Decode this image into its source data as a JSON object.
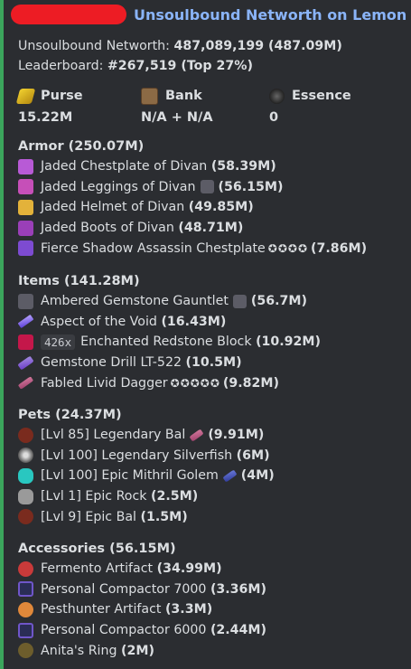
{
  "header": {
    "title": "Unsoulbound Networth on Lemon"
  },
  "summary": {
    "networth_label": "Unsoulbound Networth:",
    "networth_value": "487,089,199 (487.09M)",
    "leaderboard_label": "Leaderboard:",
    "leaderboard_value": "#267,519 (Top 27%)"
  },
  "stats": {
    "purse": {
      "label": "Purse",
      "value": "15.22M",
      "icon": "gold-ingot-icon"
    },
    "bank": {
      "label": "Bank",
      "value": "N/A + N/A",
      "icon": "chest-icon"
    },
    "essence": {
      "label": "Essence",
      "value": "0",
      "icon": "essence-orb-icon"
    }
  },
  "armor": {
    "title": "Armor (250.07M)",
    "items": [
      {
        "name": "Jaded Chestplate of Divan",
        "value": "(58.39M)"
      },
      {
        "name": "Jaded Leggings of Divan",
        "value": "(56.15M)"
      },
      {
        "name": "Jaded Helmet of Divan",
        "value": "(49.85M)"
      },
      {
        "name": "Jaded Boots of Divan",
        "value": "(48.71M)"
      },
      {
        "name": "Fierce Shadow Assassin Chestplate",
        "stars": "✪✪✪✪",
        "value": "(7.86M)"
      }
    ]
  },
  "items": {
    "title": "Items (141.28M)",
    "list": [
      {
        "name": "Ambered Gemstone Gauntlet",
        "value": "(56.7M)"
      },
      {
        "name": "Aspect of the Void",
        "value": "(16.43M)"
      },
      {
        "count": "426x",
        "name": "Enchanted Redstone Block",
        "value": "(10.92M)"
      },
      {
        "name": "Gemstone Drill LT-522",
        "value": "(10.5M)"
      },
      {
        "name": "Fabled Livid Dagger",
        "stars": "✪✪✪✪✪",
        "value": "(9.82M)"
      }
    ]
  },
  "pets": {
    "title": "Pets (24.37M)",
    "list": [
      {
        "name": "[Lvl 85] Legendary Bal",
        "value": "(9.91M)"
      },
      {
        "name": "[Lvl 100] Legendary Silverfish",
        "value": "(6M)"
      },
      {
        "name": "[Lvl 100] Epic Mithril Golem",
        "value": "(4M)"
      },
      {
        "name": "[Lvl 1] Epic Rock",
        "value": "(2.5M)"
      },
      {
        "name": "[Lvl 9] Epic Bal",
        "value": "(1.5M)"
      }
    ]
  },
  "accessories": {
    "title": "Accessories (56.15M)",
    "list": [
      {
        "name": "Fermento Artifact",
        "value": "(34.99M)"
      },
      {
        "name": "Personal Compactor 7000",
        "value": "(3.36M)"
      },
      {
        "name": "Pesthunter Artifact",
        "value": "(3.3M)"
      },
      {
        "name": "Personal Compactor 6000",
        "value": "(2.44M)"
      },
      {
        "name": "Anita's Ring",
        "value": "(2M)"
      }
    ]
  },
  "colors": {
    "accent_bar": "#3ba55c",
    "title": "#8ab4f8",
    "redaction": "#ed1c24"
  }
}
